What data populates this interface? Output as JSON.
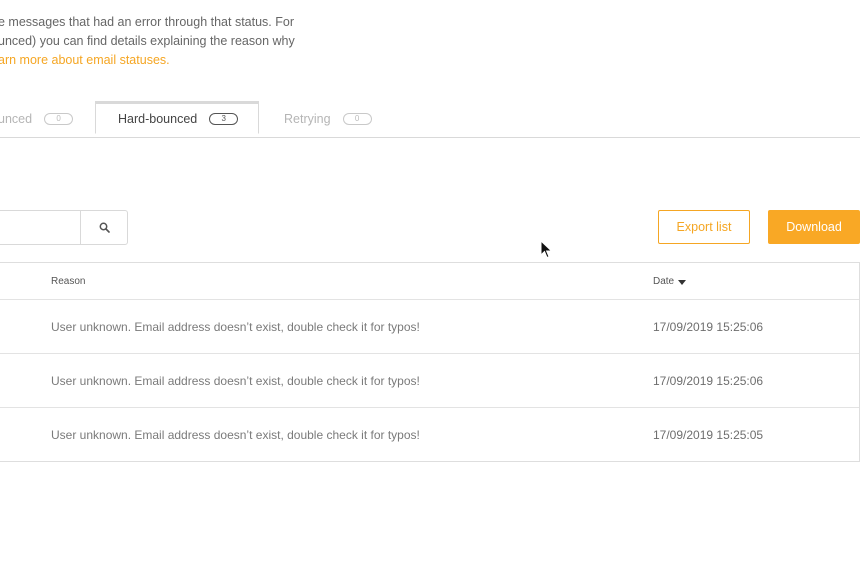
{
  "intro": {
    "line1": "e messages that had an error through that status. For",
    "line2": "unced) you can find details explaining the reason why",
    "link": "arn more about email statuses."
  },
  "tabs": [
    {
      "label": "unced",
      "count": "0",
      "active": false
    },
    {
      "label": "Hard-bounced",
      "count": "3",
      "active": true
    },
    {
      "label": "Retrying",
      "count": "0",
      "active": false
    }
  ],
  "toolbar": {
    "search_icon": "search-icon",
    "export_label": "Export list",
    "download_label": "Download"
  },
  "table": {
    "headers": {
      "reason": "Reason",
      "date": "Date"
    },
    "rows": [
      {
        "reason": "User unknown. Email address doesn’t exist, double check it for typos!",
        "date": "17/09/2019 15:25:06"
      },
      {
        "reason": "User unknown. Email address doesn’t exist, double check it for typos!",
        "date": "17/09/2019 15:25:06"
      },
      {
        "reason": "User unknown. Email address doesn’t exist, double check it for typos!",
        "date": "17/09/2019 15:25:05"
      }
    ]
  },
  "colors": {
    "accent": "#f5a623",
    "download_bg": "#f9a825"
  }
}
